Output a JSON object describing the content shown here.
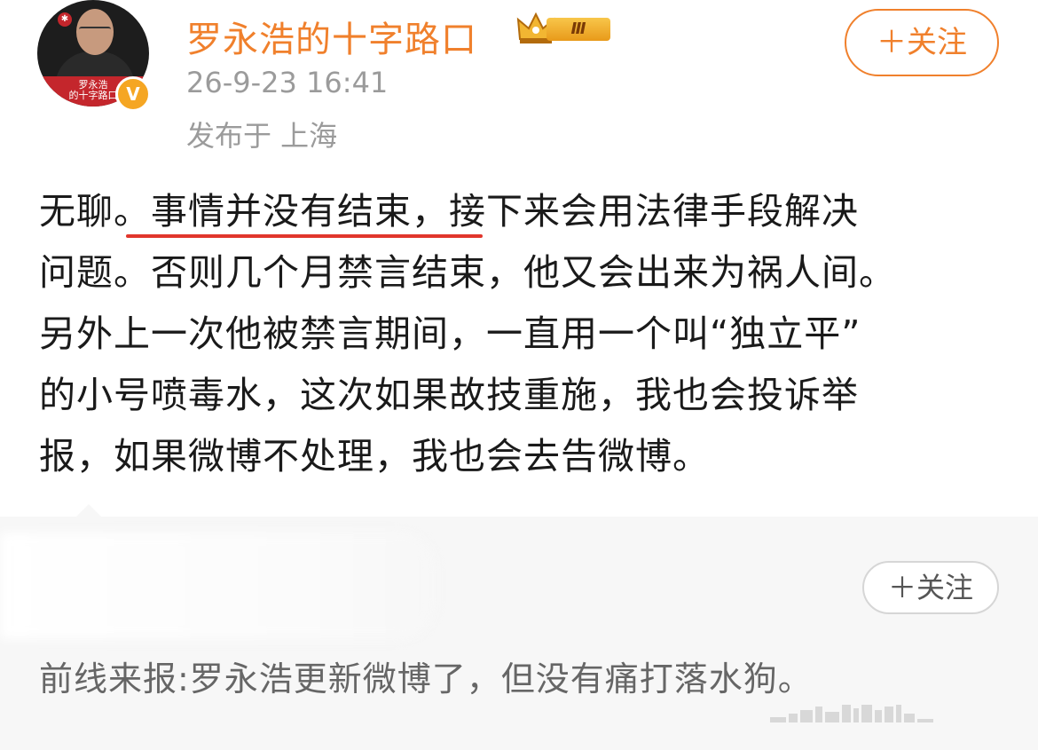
{
  "author": {
    "name": "罗永浩的十字路口",
    "avatar_banner_text": "罗永浩\n的十字路口",
    "verified_badge": "V",
    "vip_level": "Ⅲ"
  },
  "post": {
    "timestamp": "26-9-23 16:41",
    "location": "发布于 上海",
    "follow_label": "＋关注",
    "text_line1": "无聊。事情并没有结束，接下来会用法律手段解决",
    "text_line2": "问题。否则几个月禁言结束，他又会出来为祸人间。",
    "text_line3": "另外上一次他被禁言期间，一直用一个叫“独立平”",
    "text_line4": "的小号喷毒水，这次如果故技重施，我也会投诉举",
    "text_line5": "报，如果微博不处理，我也会去告微博。",
    "highlight_color": "#e1362c"
  },
  "repost": {
    "follow_label": "＋关注",
    "text": "前线来报:罗永浩更新微博了，但没有痛打落水狗。"
  },
  "icons": {
    "avatar": "avatar-image",
    "verified": "verified-v-icon",
    "vip": "crown-vip-icon"
  },
  "colors": {
    "accent": "#f0802c",
    "text": "#1a1a1a",
    "muted": "#9b9b9b",
    "repost_bg": "#f7f7f7"
  }
}
